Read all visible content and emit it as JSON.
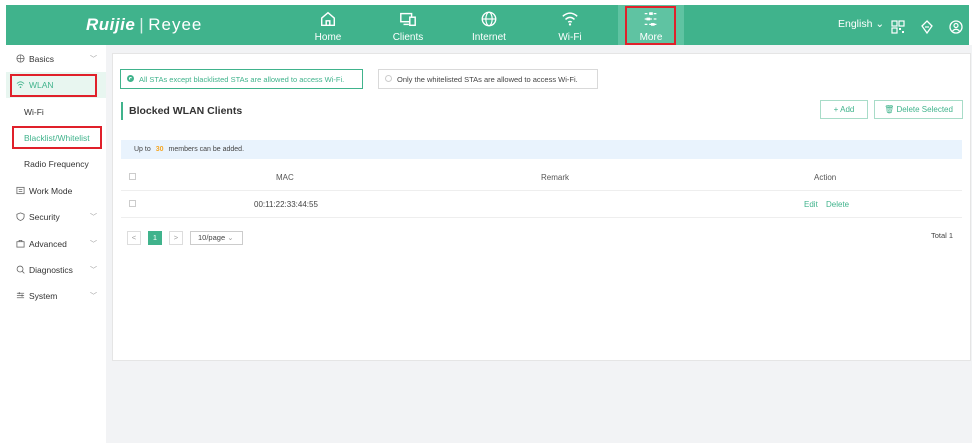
{
  "header": {
    "brand": "Ruijie",
    "brand_sep": "|",
    "sub_brand": "Reyee",
    "nav": [
      {
        "label": "Home",
        "icon": "home-icon"
      },
      {
        "label": "Clients",
        "icon": "clients-icon"
      },
      {
        "label": "Internet",
        "icon": "globe-icon"
      },
      {
        "label": "Wi-Fi",
        "icon": "wifi-icon"
      },
      {
        "label": "More",
        "icon": "more-icon"
      }
    ],
    "language": "English",
    "colors": {
      "accent": "#40b38c",
      "highlight": "#e0202a"
    }
  },
  "sidebar": {
    "items": [
      {
        "label": "Basics",
        "icon": "globe-icon"
      },
      {
        "label": "WLAN",
        "icon": "wifi-icon"
      },
      {
        "label": "Wi-Fi"
      },
      {
        "label": "Blacklist/Whitelist"
      },
      {
        "label": "Radio Frequency"
      },
      {
        "label": "Work Mode",
        "icon": "workmode-icon"
      },
      {
        "label": "Security",
        "icon": "shield-icon"
      },
      {
        "label": "Advanced",
        "icon": "advanced-icon"
      },
      {
        "label": "Diagnostics",
        "icon": "diagnostics-icon"
      },
      {
        "label": "System",
        "icon": "system-icon"
      }
    ]
  },
  "main": {
    "mode_options": [
      "All STAs except blacklisted STAs are allowed to access Wi-Fi.",
      "Only the whitelisted STAs are allowed to access Wi-Fi."
    ],
    "section_title": "Blocked WLAN Clients",
    "add_label": "+ Add",
    "delete_selected_label": "Delete Selected",
    "notice_prefix": "Up to",
    "notice_count": "30",
    "notice_suffix": "members can be added.",
    "table": {
      "columns": [
        "MAC",
        "Remark",
        "Action"
      ],
      "rows": [
        {
          "mac": "00:11:22:33:44:55",
          "remark": "",
          "actions": [
            "Edit",
            "Delete"
          ]
        }
      ]
    },
    "pagination": {
      "current": "1",
      "page_size": "10/page",
      "total": "Total 1",
      "prev": "<",
      "next": ">"
    }
  }
}
